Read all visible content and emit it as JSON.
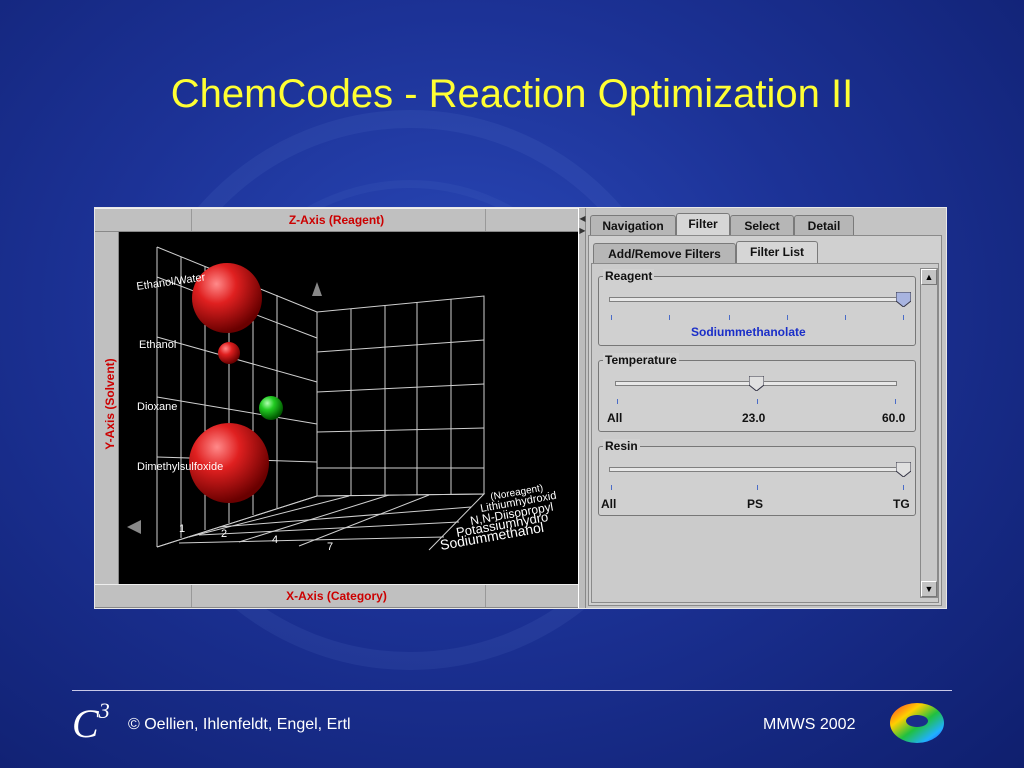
{
  "slide": {
    "title": "ChemCodes - Reaction Optimization II",
    "footer_copyright": "© Oellien, Ihlenfeldt, Engel, Ertl",
    "footer_conference": "MMWS 2002",
    "logo_text": "C",
    "logo_superscript": "3"
  },
  "viewer": {
    "z_axis_label": "Z-Axis (Reagent)",
    "x_axis_label": "X-Axis (Category)",
    "y_axis_label": "Y-Axis (Solvent)",
    "solvents": [
      "Ethanol/Water",
      "Ethanol",
      "Dioxane",
      "Dimethylsulfoxide"
    ],
    "categories": [
      "1",
      "2",
      "4",
      "7"
    ],
    "reagents": [
      "(Noreagent)",
      "Lithiumhydroxid",
      "N,N-Diisopropyl",
      "Potassiumhydro",
      "Sodiummethanol"
    ],
    "colors": {
      "sphere_red": "#e02020",
      "sphere_green": "#22cc22",
      "grid": "#cfcfcf",
      "axis_label": "#cc0000"
    }
  },
  "panel": {
    "tabs": [
      "Navigation",
      "Filter",
      "Select",
      "Detail"
    ],
    "active_tab": "Filter",
    "subtabs": [
      "Add/Remove Filters",
      "Filter List"
    ],
    "active_subtab": "Filter List",
    "filters": {
      "reagent": {
        "label": "Reagent",
        "value_label": "Sodiummethanolate",
        "position": 1.0
      },
      "temperature": {
        "label": "Temperature",
        "min_label": "All",
        "mid_label": "23.0",
        "max_label": "60.0",
        "position": 0.5
      },
      "resin": {
        "label": "Resin",
        "min_label": "All",
        "mid_label": "PS",
        "max_label": "TG",
        "position": 1.0
      }
    }
  }
}
